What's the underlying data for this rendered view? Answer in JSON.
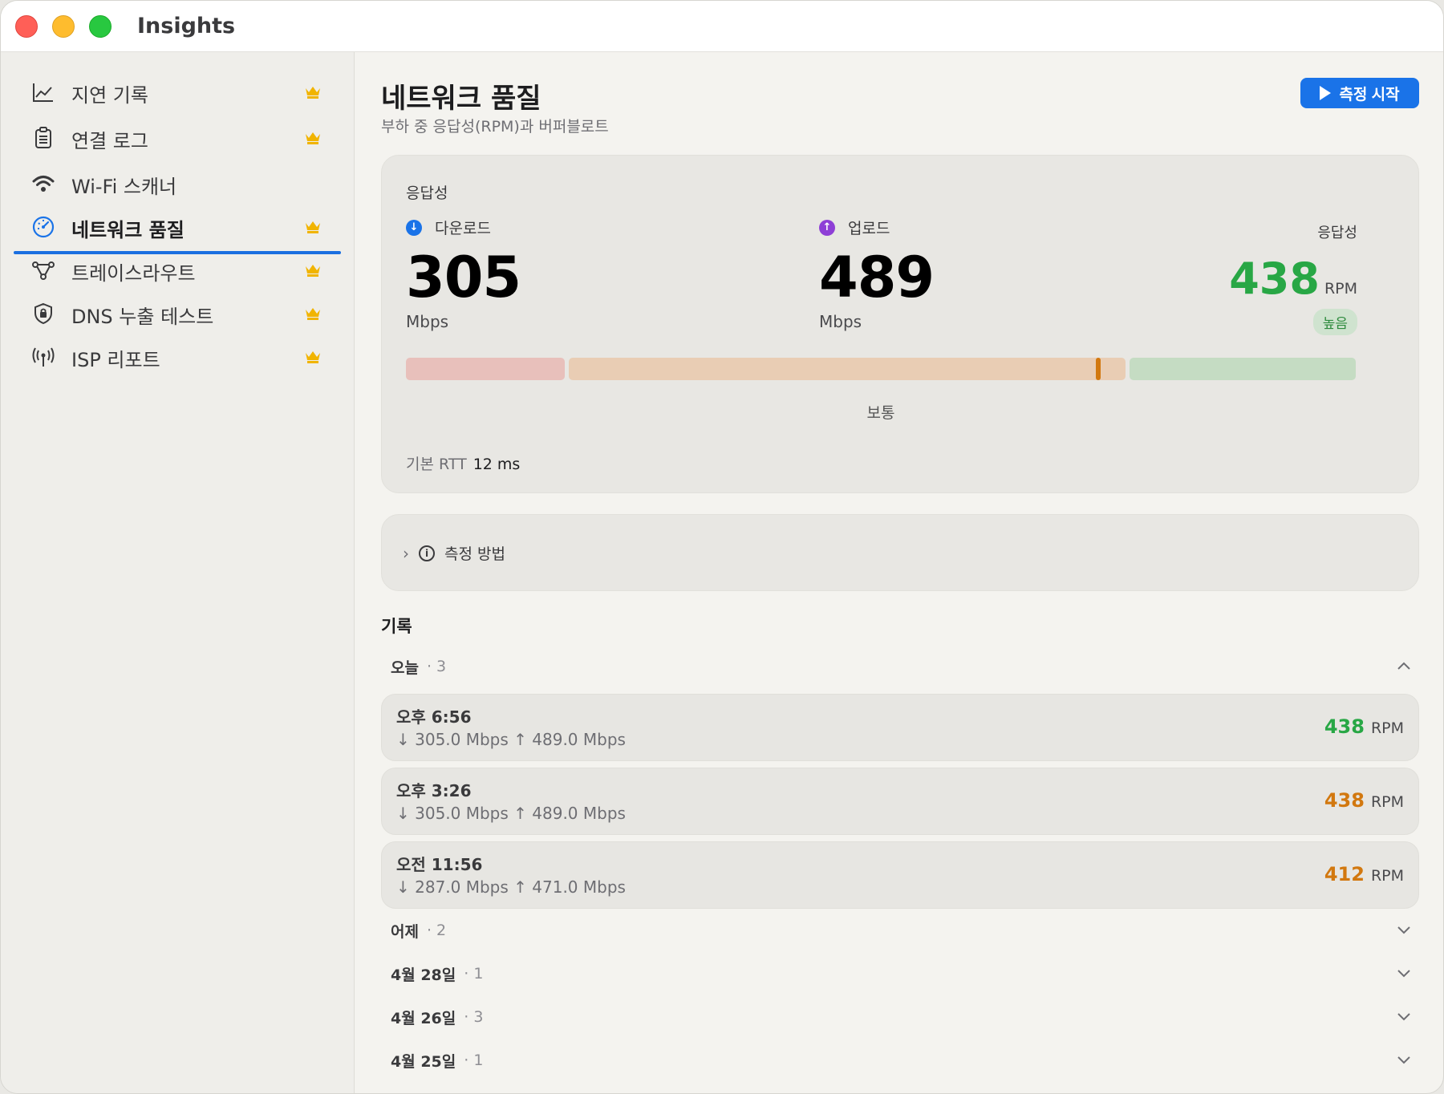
{
  "window": {
    "title": "Insights"
  },
  "sidebar": {
    "items": [
      {
        "label": "지연 기록",
        "icon": "chart-line-icon",
        "premium": true,
        "active": false
      },
      {
        "label": "연결 로그",
        "icon": "clipboard-icon",
        "premium": true,
        "active": false
      },
      {
        "label": "Wi-Fi 스캐너",
        "icon": "wifi-icon",
        "premium": false,
        "active": false
      },
      {
        "label": "네트워크 품질",
        "icon": "gauge-icon",
        "premium": true,
        "active": true
      },
      {
        "label": "트레이스라우트",
        "icon": "route-icon",
        "premium": true,
        "active": false
      },
      {
        "label": "DNS 누출 테스트",
        "icon": "shield-icon",
        "premium": true,
        "active": false
      },
      {
        "label": "ISP 리포트",
        "icon": "antenna-icon",
        "premium": true,
        "active": false
      }
    ]
  },
  "header": {
    "title": "네트워크 품질",
    "subtitle": "부하 중 응답성(RPM)과 버퍼블로트",
    "start_button": "측정 시작"
  },
  "responsiveness": {
    "title": "응답성",
    "download": {
      "label": "다운로드",
      "value": "305",
      "unit": "Mbps"
    },
    "upload": {
      "label": "업로드",
      "value": "489",
      "unit": "Mbps"
    },
    "rpm": {
      "label": "응답성",
      "value": "438",
      "unit": "RPM",
      "badge": "높음"
    },
    "scale_label": "보통",
    "rtt_label": "기본 RTT",
    "rtt_value": "12 ms",
    "colors": {
      "good": "#28a745",
      "moderate": "#d2780f"
    }
  },
  "method": {
    "label": "측정 방법"
  },
  "history": {
    "title": "기록",
    "groups": [
      {
        "name": "오늘",
        "count": "· 3",
        "expanded": true
      },
      {
        "name": "어제",
        "count": "· 2",
        "expanded": false
      },
      {
        "name": "4월 28일",
        "count": "· 1",
        "expanded": false
      },
      {
        "name": "4월 26일",
        "count": "· 3",
        "expanded": false
      },
      {
        "name": "4월 25일",
        "count": "· 1",
        "expanded": false
      }
    ],
    "records": [
      {
        "time": "오후 6:56",
        "speeds": "↓ 305.0 Mbps  ↑ 489.0 Mbps",
        "rpm": "438",
        "unit": "RPM",
        "color": "#28a745"
      },
      {
        "time": "오후 3:26",
        "speeds": "↓ 305.0 Mbps  ↑ 489.0 Mbps",
        "rpm": "438",
        "unit": "RPM",
        "color": "#d2780f"
      },
      {
        "time": "오전 11:56",
        "speeds": "↓ 287.0 Mbps  ↑ 471.0 Mbps",
        "rpm": "412",
        "unit": "RPM",
        "color": "#d2780f"
      }
    ]
  }
}
